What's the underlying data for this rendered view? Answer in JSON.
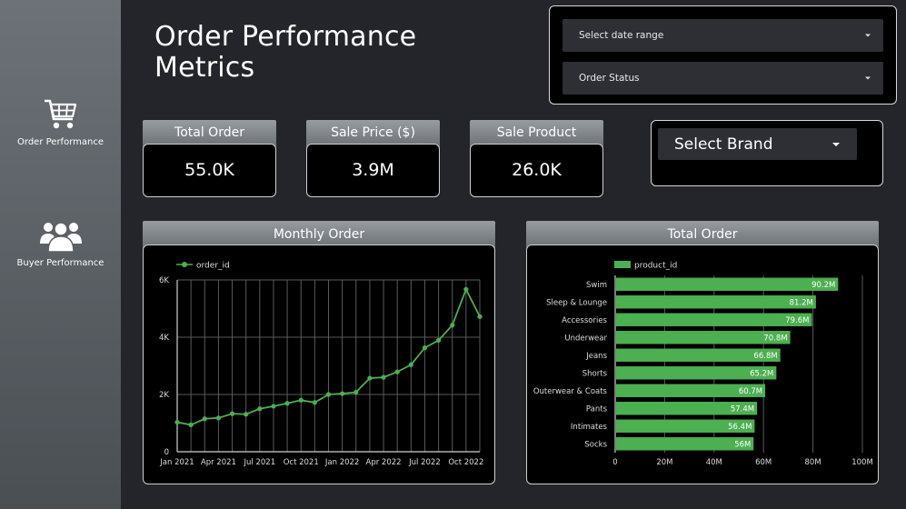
{
  "sidebar": {
    "items": [
      {
        "label": "Order Performance",
        "icon": "shopping-cart-icon"
      },
      {
        "label": "Buyer Performance",
        "icon": "users-icon"
      }
    ]
  },
  "header": {
    "title_line1": "Order Performance",
    "title_line2": "Metrics"
  },
  "filters": {
    "date_range": "Select date range",
    "order_status": "Order Status",
    "brand": "Select Brand"
  },
  "kpis": [
    {
      "label": "Total Order",
      "value": "55.0K"
    },
    {
      "label": "Sale Price ($)",
      "value": "3.9M"
    },
    {
      "label": "Sale Product",
      "value": "26.0K"
    }
  ],
  "colors": {
    "series": "#4caf50",
    "header_grey": "#80858a",
    "background": "#24252a"
  },
  "chart_data": [
    {
      "type": "line",
      "title": "Monthly Order",
      "legend": {
        "entries": [
          "order_id"
        ],
        "placement": "top-left"
      },
      "x": [
        "Jan 2021",
        "Feb 2021",
        "Mar 2021",
        "Apr 2021",
        "May 2021",
        "Jun 2021",
        "Jul 2021",
        "Aug 2021",
        "Sep 2021",
        "Oct 2021",
        "Nov 2021",
        "Dec 2021",
        "Jan 2022",
        "Feb 2022",
        "Mar 2022",
        "Apr 2022",
        "May 2022",
        "Jun 2022",
        "Jul 2022",
        "Aug 2022",
        "Sep 2022",
        "Oct 2022",
        "Nov 2022"
      ],
      "x_ticks": [
        "Jan 2021",
        "Apr 2021",
        "Jul 2021",
        "Oct 2021",
        "Jan 2022",
        "Apr 2022",
        "Jul 2022",
        "Oct 2022"
      ],
      "series": [
        {
          "name": "order_id",
          "values": [
            1030,
            940,
            1150,
            1180,
            1330,
            1310,
            1500,
            1590,
            1690,
            1800,
            1720,
            2000,
            2030,
            2080,
            2570,
            2600,
            2790,
            3040,
            3630,
            3890,
            4420,
            5670,
            4720
          ]
        }
      ],
      "y_ticks": [
        "0",
        "2K",
        "4K",
        "6K"
      ],
      "ylim": [
        0,
        6000
      ],
      "grid": true
    },
    {
      "type": "bar",
      "orientation": "horizontal",
      "title": "Total Order",
      "legend": {
        "entries": [
          "product_id"
        ],
        "placement": "top-left"
      },
      "categories": [
        "Swim",
        "Sleep & Lounge",
        "Accessories",
        "Underwear",
        "Jeans",
        "Shorts",
        "Outerwear & Coats",
        "Pants",
        "Intimates",
        "Socks"
      ],
      "series": [
        {
          "name": "product_id",
          "values": [
            90.2,
            81.2,
            79.6,
            70.8,
            66.8,
            65.2,
            60.7,
            57.4,
            56.4,
            56.0
          ]
        }
      ],
      "data_labels": [
        "90.2M",
        "81.2M",
        "79.6M",
        "70.8M",
        "66.8M",
        "65.2M",
        "60.7M",
        "57.4M",
        "56.4M",
        "56M"
      ],
      "x_ticks": [
        "0",
        "20M",
        "40M",
        "60M",
        "80M",
        "100M"
      ],
      "xlim": [
        0,
        100
      ],
      "grid": true
    }
  ]
}
